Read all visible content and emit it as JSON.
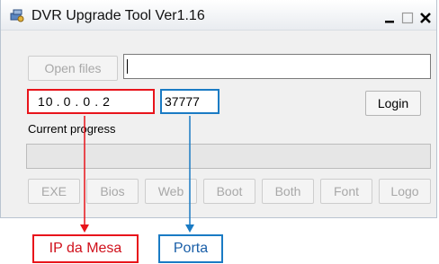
{
  "window": {
    "title": "DVR Upgrade Tool Ver1.16",
    "icon": "dvr-tool-icon",
    "controls": [
      "minimize-icon",
      "maximize-icon",
      "close-icon"
    ]
  },
  "file": {
    "open_label": "Open files",
    "path_value": ""
  },
  "connection": {
    "ip": {
      "o1": "10",
      "o2": "0",
      "o3": "0",
      "o4": "2",
      "sep": "."
    },
    "port": "37777",
    "login_label": "Login"
  },
  "progress": {
    "label": "Current progress",
    "value": 0
  },
  "upgrade_buttons": [
    "EXE",
    "Bios",
    "Web",
    "Boot",
    "Both",
    "Font",
    "Logo"
  ],
  "annotations": {
    "ip_label": "IP da Mesa",
    "port_label": "Porta",
    "ip_color": "#e8141b",
    "port_color": "#1a7bc4"
  }
}
